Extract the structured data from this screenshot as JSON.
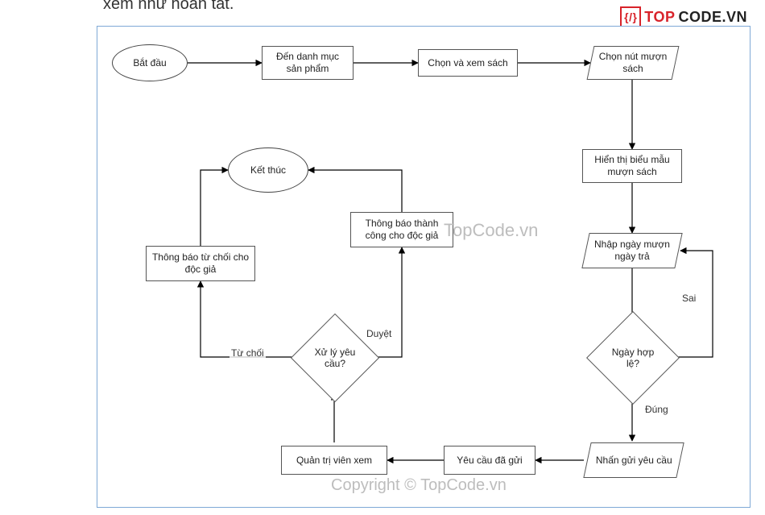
{
  "cropped_text_top": "xem như hoàn tất.",
  "logo": {
    "braces": "{/}",
    "text1": "TOP",
    "text2": "CODE.VN"
  },
  "watermarks": {
    "center": "TopCode.vn",
    "bottom": "Copyright © TopCode.vn"
  },
  "nodes": {
    "start": {
      "label": "Bắt đầu"
    },
    "catalog": {
      "label": "Đến danh mục sản phẩm"
    },
    "view_book": {
      "label": "Chọn và xem sách"
    },
    "borrow_btn": {
      "label": "Chọn nút mượn sách"
    },
    "show_form": {
      "label": "Hiển thị biểu mẫu mượn sách"
    },
    "enter_dates": {
      "label": "Nhập ngày mượn ngày trả"
    },
    "valid_date": {
      "label": "Ngày hợp lệ?"
    },
    "send_request": {
      "label": "Nhấn gửi yêu cầu"
    },
    "request_sent": {
      "label": "Yêu cầu đã gửi"
    },
    "admin_view": {
      "label": "Quản trị viên xem"
    },
    "process": {
      "label": "Xử lý yêu cầu?"
    },
    "notify_reject": {
      "label": "Thông báo từ chối cho độc giả"
    },
    "notify_success": {
      "label": "Thông báo thành công cho độc giả"
    },
    "end": {
      "label": "Kết thúc"
    }
  },
  "edge_labels": {
    "valid_true": "Đúng",
    "valid_false": "Sai",
    "approve": "Duyệt",
    "reject": "Từ chối"
  },
  "flow": [
    "start → catalog → view_book → borrow_btn → show_form → enter_dates → valid_date",
    "valid_date --Sai--> enter_dates",
    "valid_date --Đúng--> send_request → request_sent → admin_view → process",
    "process --Duyệt--> notify_success → end",
    "process --Từ chối--> notify_reject → end"
  ]
}
